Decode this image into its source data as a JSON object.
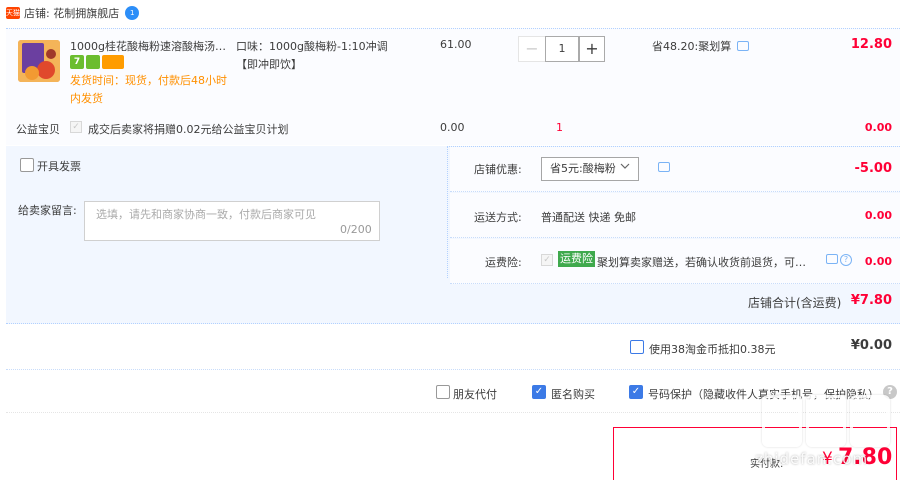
{
  "shop": {
    "name": "店铺: 花制拥旗舰店",
    "icon": "tmall-icon",
    "badge_count": "1"
  },
  "item": {
    "title": "1000g桂花酸梅粉速溶酸梅汤晶...",
    "badge_1": "7",
    "ship_time_line1": "发货时间：现货，付款后48小时",
    "ship_time_line2": "内发货",
    "sku_line1": "口味：1000g酸梅粉-1:10冲调",
    "sku_line2": "【即冲即饮】",
    "unit_price": "61.00",
    "quantity": "1",
    "minus": "−",
    "plus": "+",
    "promo": "省48.20:聚划算",
    "total": "12.80"
  },
  "charity": {
    "label": "公益宝贝",
    "text": "成交后卖家将捐赠0.02元给公益宝贝计划",
    "price": "0.00",
    "qty": "1",
    "total": "0.00"
  },
  "invoice": {
    "label": "开具发票",
    "checked": false
  },
  "message": {
    "label": "给卖家留言:",
    "placeholder": "选填，请先和商家协商一致，付款后商家可见",
    "count": "0/200"
  },
  "coupon": {
    "label": "店铺优惠:",
    "selected": "省5元:酸梅粉",
    "value": "-5.00"
  },
  "shipping": {
    "label": "运送方式:",
    "method": "普通配送 快递 免邮",
    "cost": "0.00"
  },
  "insurance": {
    "label": "运费险:",
    "badge": "运费险",
    "text": "聚划算卖家赠送，若确认收货前退货，可获...",
    "cost": "0.00"
  },
  "store_total": {
    "label": "店铺合计(含运费)",
    "value": "¥7.80"
  },
  "coins": {
    "label": "使用38淘金币抵扣0.38元",
    "value": "¥0.00",
    "checked": false
  },
  "options": {
    "friend_pay": "朋友代付",
    "anonymous": "匿名购买",
    "privacy": "号码保护（隐藏收件人真实手机号，保护隐私）"
  },
  "payment": {
    "label": "实付款:",
    "currency": "¥",
    "value": "7.80"
  },
  "watermark": {
    "url": "zhidefan.com"
  },
  "colors": {
    "accent_red": "#ff0036",
    "accent_blue": "#3c7ae6",
    "orange": "#ff9000",
    "area_bg": "#f2f7ff"
  }
}
